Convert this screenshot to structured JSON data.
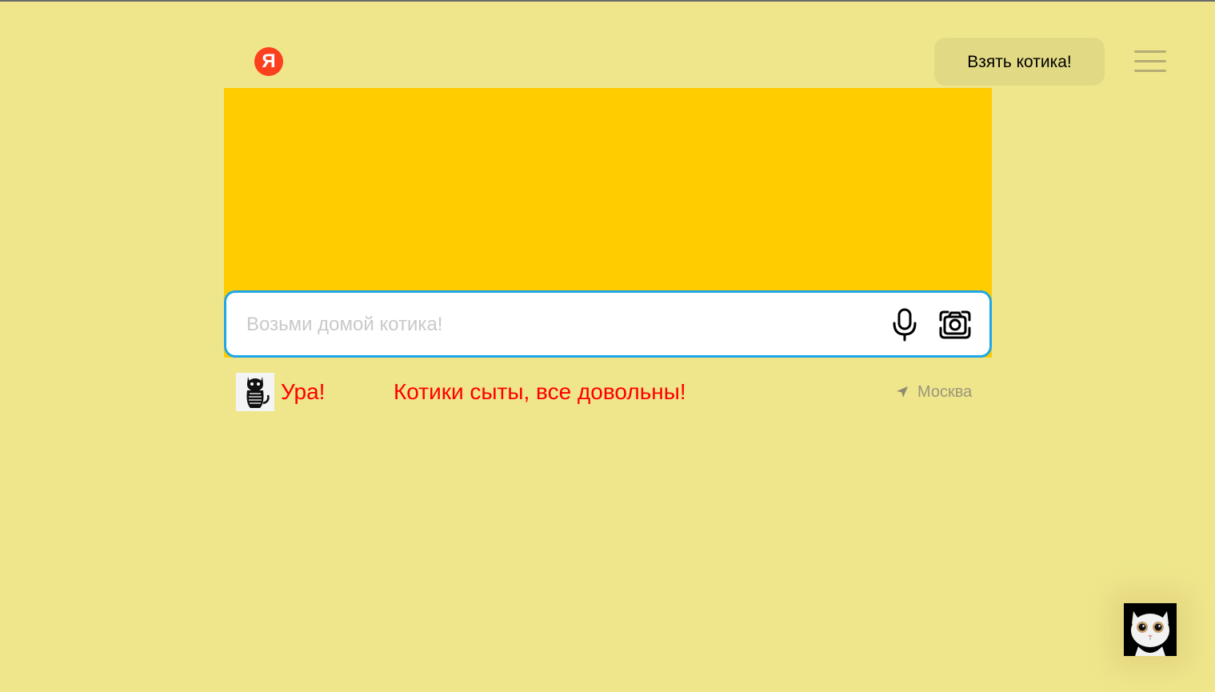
{
  "header": {
    "logo_letter": "Я",
    "take_button_label": "Взять котика!"
  },
  "search": {
    "placeholder": "Возьми домой котика!",
    "value": ""
  },
  "info": {
    "hooray": "Ура!",
    "status": "Котики сыты, все довольны!",
    "location": "Москва"
  },
  "icons": {
    "logo": "yandex-logo",
    "menu": "hamburger-menu-icon",
    "mic": "microphone-icon",
    "camera": "camera-search-icon",
    "location": "location-arrow-icon",
    "cat_thumb": "black-cat-image",
    "cat_widget": "white-cat-image"
  },
  "colors": {
    "page_background": "#efe68c",
    "banner": "#ffcc00",
    "search_border": "#1ea7e8",
    "logo": "#fc3f1d",
    "status_text": "#ff0000",
    "take_button": "#e2d985"
  }
}
